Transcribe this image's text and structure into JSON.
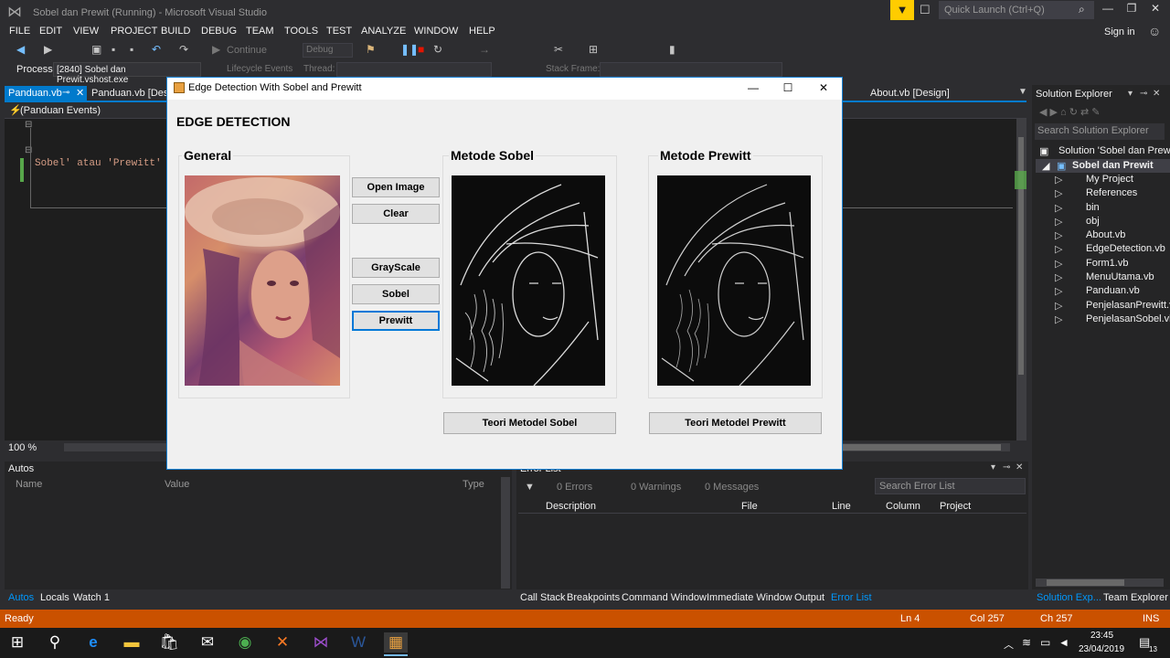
{
  "window": {
    "title": "Sobel dan Prewit (Running) - Microsoft Visual Studio",
    "quick_launch_placeholder": "Quick Launch (Ctrl+Q)",
    "sign_in": "Sign in"
  },
  "menu": [
    "FILE",
    "EDIT",
    "VIEW",
    "PROJECT",
    "BUILD",
    "DEBUG",
    "TEAM",
    "TOOLS",
    "TEST",
    "ANALYZE",
    "WINDOW",
    "HELP"
  ],
  "toolbar": {
    "continue_label": "Continue",
    "config": "Debug"
  },
  "process": {
    "label": "Process:",
    "value": "[2840] Sobel dan Prewit.vshost.exe",
    "lifecycle": "Lifecycle Events",
    "thread_label": "Thread:",
    "stack_frame_label": "Stack Frame:"
  },
  "editor": {
    "tabs": [
      "Panduan.vb",
      "Panduan.vb [Design]",
      "About.vb [Design]"
    ],
    "nav_events": "(Panduan Events)",
    "code_line": "Sobel' atau 'Prewitt' Un",
    "zoom": "100 %"
  },
  "autos": {
    "title": "Autos",
    "columns": [
      "Name",
      "Value",
      "Type"
    ],
    "tabs": [
      "Autos",
      "Locals",
      "Watch 1"
    ]
  },
  "error_list": {
    "title": "Error List",
    "errors": "0 Errors",
    "warnings": "0 Warnings",
    "messages": "0 Messages",
    "search_placeholder": "Search Error List",
    "columns": [
      "Description",
      "File",
      "Line",
      "Column",
      "Project"
    ],
    "tabs": [
      "Call Stack",
      "Breakpoints",
      "Command Window",
      "Immediate Window",
      "Output",
      "Error List"
    ]
  },
  "solution_explorer": {
    "title": "Solution Explorer",
    "search_placeholder": "Search Solution Explorer",
    "solution": "Solution 'Sobel dan Prewit",
    "project": "Sobel dan Prewit",
    "items": [
      "My Project",
      "References",
      "bin",
      "obj",
      "About.vb",
      "EdgeDetection.vb",
      "Form1.vb",
      "MenuUtama.vb",
      "Panduan.vb",
      "PenjelasanPrewitt.vb",
      "PenjelasanSobel.vb"
    ],
    "tabs": [
      "Solution Exp...",
      "Team Explorer"
    ]
  },
  "status": {
    "state": "Ready",
    "ln": "Ln 4",
    "col": "Col 257",
    "ch": "Ch 257",
    "ins": "INS"
  },
  "clock": {
    "time": "23:45",
    "date": "23/04/2019"
  },
  "notification_count": "13",
  "dialog": {
    "title": "Edge Detection With Sobel and Prewitt",
    "heading": "EDGE DETECTION",
    "group_general": "General",
    "group_sobel": "Metode Sobel",
    "group_prewitt": "Metode Prewitt",
    "buttons": {
      "open_image": "Open Image",
      "clear": "Clear",
      "grayscale": "GrayScale",
      "sobel": "Sobel",
      "prewitt": "Prewitt",
      "teori_sobel": "Teori Metodel Sobel",
      "teori_prewitt": "Teori Metodel Prewitt"
    }
  },
  "colors": {
    "accent": "#007acc",
    "status_bar": "#ca5100",
    "dialog_border": "#1883d7"
  }
}
